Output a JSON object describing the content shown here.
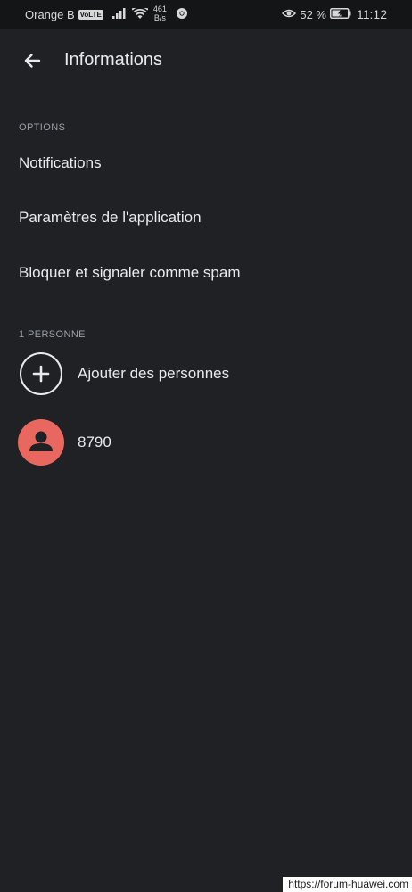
{
  "status_bar": {
    "carrier": "Orange B",
    "volte": "VoLTE",
    "speed_value": "461",
    "speed_unit": "B/s",
    "battery_percent": "52 %",
    "time": "11:12"
  },
  "app_bar": {
    "title": "Informations",
    "back_icon": "arrow-back-icon"
  },
  "options": {
    "header": "OPTIONS",
    "items": [
      {
        "label": "Notifications"
      },
      {
        "label": "Paramètres de l'application"
      },
      {
        "label": "Bloquer et signaler comme spam"
      }
    ]
  },
  "people": {
    "header": "1 PERSONNE",
    "add_label": "Ajouter des personnes",
    "add_icon": "plus-icon",
    "members": [
      {
        "name": "8790",
        "avatar_color": "#e8685f",
        "icon": "person-icon"
      }
    ]
  },
  "watermark": "https://forum-huawei.com",
  "colors": {
    "background": "#202124",
    "status_bar": "#141517",
    "text_primary": "#e8eaed",
    "text_secondary": "#9aa0a6",
    "avatar": "#e8685f"
  }
}
